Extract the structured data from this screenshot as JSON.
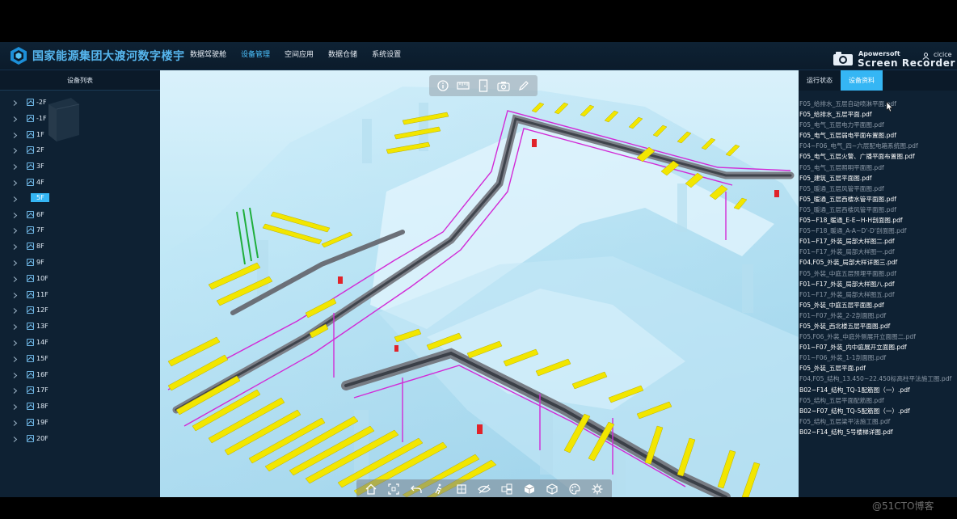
{
  "header": {
    "app_title": "国家能源集团大渡河数字楼宇",
    "nav": [
      "数据驾驶舱",
      "设备管理",
      "空间应用",
      "数据仓储",
      "系统设置"
    ],
    "active_nav_index": 1,
    "recorder_brand_top": "Apowersoft",
    "recorder_brand_bottom": "Screen Recorder",
    "user_name": "cicice"
  },
  "left_panel": {
    "title": "设备列表",
    "floors": [
      "-2F",
      "-1F",
      "1F",
      "2F",
      "3F",
      "4F",
      "5F",
      "6F",
      "7F",
      "8F",
      "9F",
      "10F",
      "11F",
      "12F",
      "13F",
      "14F",
      "15F",
      "16F",
      "17F",
      "18F",
      "19F",
      "20F"
    ],
    "selected_floor": "5F"
  },
  "viewport": {
    "top_toolbar_icons": [
      "info-icon",
      "measure-icon",
      "door-icon",
      "camera-icon",
      "pen-icon"
    ],
    "bottom_toolbar_icons": [
      "home-icon",
      "frame-icon",
      "undo-icon",
      "walk-icon",
      "section-box-icon",
      "hide-icon",
      "explode-icon",
      "cube-icon",
      "cube-outline-icon",
      "palette-icon",
      "gear-icon"
    ]
  },
  "right_panel": {
    "tabs": [
      "运行状态",
      "设备资料"
    ],
    "active_tab_index": 1,
    "files": [
      {
        "name": "F05_给排水_五层自动喷淋平面.pdf",
        "style": "dim"
      },
      {
        "name": "F05_给排水_五层平面.pdf",
        "style": "bright"
      },
      {
        "name": "F05_电气_五层电力平面图.pdf",
        "style": "dim"
      },
      {
        "name": "F05_电气_五层弱电平面布置图.pdf",
        "style": "bright"
      },
      {
        "name": "F04~F06_电气_四~六层配电箱系统图.pdf",
        "style": "dim"
      },
      {
        "name": "F05_电气_五层火警、广播平面布置图.pdf",
        "style": "bright"
      },
      {
        "name": "F05_电气_五层照明平面图.pdf",
        "style": "dim"
      },
      {
        "name": "F05_建筑_五层平面图.pdf",
        "style": "bright"
      },
      {
        "name": "F05_暖通_五层风管平面图.pdf",
        "style": "dim"
      },
      {
        "name": "F05_暖通_五层西楼水管平面图.pdf",
        "style": "bright"
      },
      {
        "name": "F05_暖通_五层西楼风管平面图.pdf",
        "style": "dim"
      },
      {
        "name": "F05~F18_暖通_E-E~H-H剖面图.pdf",
        "style": "bright"
      },
      {
        "name": "F05~F18_暖通_A-A~D'-D'剖面图.pdf",
        "style": "dim"
      },
      {
        "name": "F01~F17_外装_局部大样图二.pdf",
        "style": "bright"
      },
      {
        "name": "F01~F17_外装_局部大样图一.pdf",
        "style": "dim"
      },
      {
        "name": "F04,F05_外装_局部大样详图三.pdf",
        "style": "bright"
      },
      {
        "name": "F05_外装_中庭五层预埋平面图.pdf",
        "style": "dim"
      },
      {
        "name": "F01~F17_外装_局部大样图八.pdf",
        "style": "bright"
      },
      {
        "name": "F01~F17_外装_局部大样图五.pdf",
        "style": "dim"
      },
      {
        "name": "F05_外装_中庭五层平面图.pdf",
        "style": "bright"
      },
      {
        "name": "F01~F07_外装_2-2剖面图.pdf",
        "style": "dim"
      },
      {
        "name": "F05_外装_西北楼五层平面图.pdf",
        "style": "bright"
      },
      {
        "name": "F05,F06_外装_中庭外侧展开立面图二.pdf",
        "style": "dim"
      },
      {
        "name": "F01~F07_外装_内中庭展开立面图.pdf",
        "style": "bright"
      },
      {
        "name": "F01~F06_外装_1-1剖面图.pdf",
        "style": "dim"
      },
      {
        "name": "F05_外装_五层平面.pdf",
        "style": "bright"
      },
      {
        "name": "F04,F05_结构_13.450~22.450标高柱平法施工图.pdf",
        "style": "dim"
      },
      {
        "name": "B02~F14_结构_TQ-1配筋图（一）.pdf",
        "style": "bright"
      },
      {
        "name": "F05_结构_五层平面配筋图.pdf",
        "style": "dim"
      },
      {
        "name": "B02~F07_结构_TQ-5配筋图（一）.pdf",
        "style": "bright"
      },
      {
        "name": "F05_结构_五层梁平法施工图.pdf",
        "style": "dim"
      },
      {
        "name": "B02~F14_结构_5号楼梯详图.pdf",
        "style": "bright"
      }
    ]
  },
  "watermark": "@51CTO博客",
  "colors": {
    "accent": "#35b6f4",
    "panel_bg": "#0e2133",
    "header_bg": "#0b1b2b",
    "cable_tray_yellow": "#f2e600",
    "pipe_magenta": "#d22ad6",
    "glass_blue": "#9fd6ec"
  }
}
